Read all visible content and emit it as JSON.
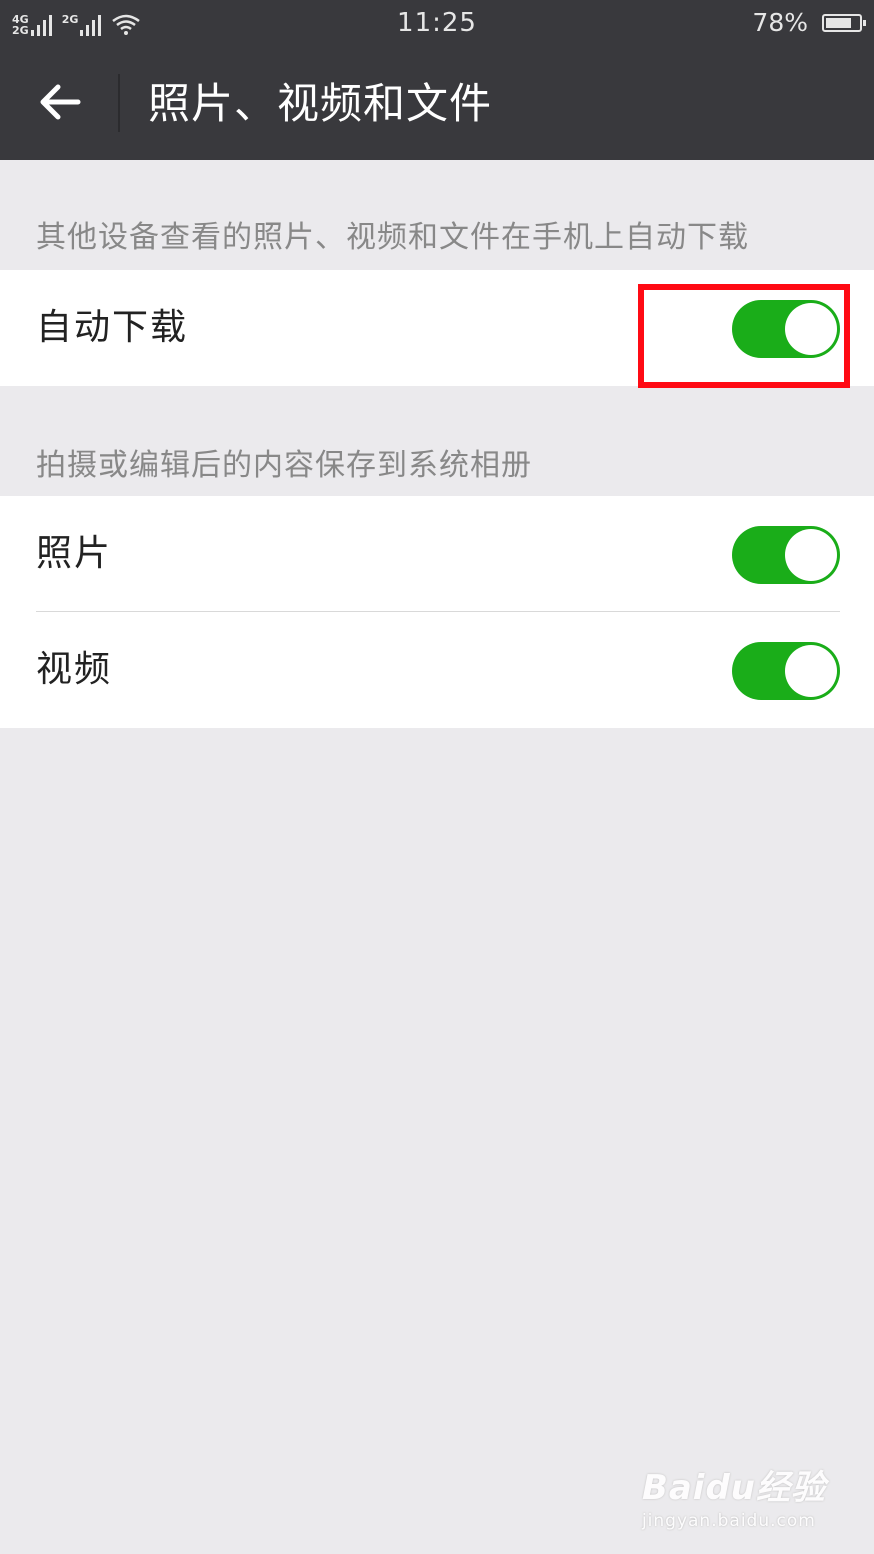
{
  "status_bar": {
    "network_1": [
      "4G",
      "2G"
    ],
    "network_2": "2G",
    "time": "11:25",
    "battery_percent": "78%",
    "battery_level": 0.78
  },
  "header": {
    "title": "照片、视频和文件",
    "back_icon": "back-arrow-icon"
  },
  "sections": [
    {
      "header": "其他设备查看的照片、视频和文件在手机上自动下载",
      "rows": [
        {
          "label": "自动下载",
          "enabled": true
        }
      ]
    },
    {
      "header": "拍摄或编辑后的内容保存到系统相册",
      "rows": [
        {
          "label": "照片",
          "enabled": true
        },
        {
          "label": "视频",
          "enabled": true
        }
      ]
    }
  ],
  "colors": {
    "toggle_on": "#1aad19",
    "highlight": "#ff0a14",
    "header_bg": "#39393d",
    "page_bg": "#ebeaed"
  },
  "watermark": {
    "logo": "Baidu经验",
    "url": "jingyan.baidu.com"
  }
}
